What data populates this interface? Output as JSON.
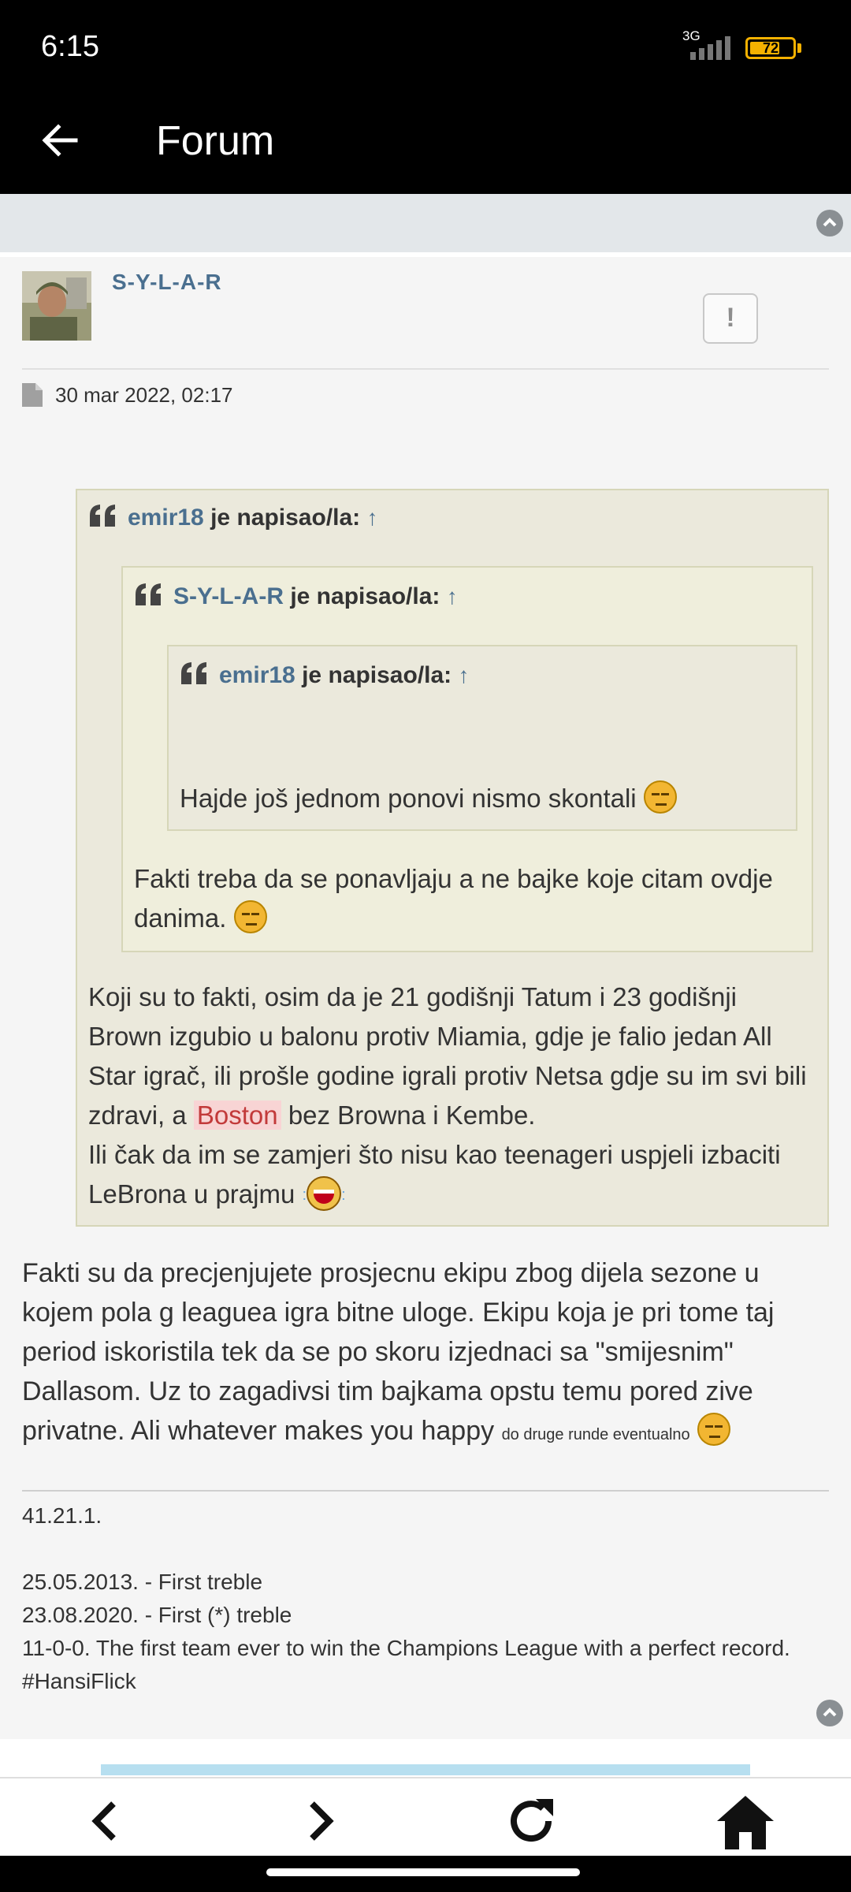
{
  "status_bar": {
    "time": "6:15",
    "network": "3G",
    "battery": "72",
    "battery_level": 0.72
  },
  "app_bar": {
    "title": "Forum"
  },
  "post": {
    "author": "S-Y-L-A-R",
    "report_label": "!",
    "date": "30 mar 2022, 02:17",
    "quote_outer": {
      "author": "emir18",
      "suffix": "je napisao/la:",
      "arrow": "↑",
      "quote_middle": {
        "author": "S-Y-L-A-R",
        "suffix": "je napisao/la:",
        "arrow": "↑",
        "quote_inner": {
          "author": "emir18",
          "suffix": "je napisao/la:",
          "arrow": "↑",
          "text": "Hajde još jednom ponovi nismo skontali"
        },
        "text": "Fakti treba da se ponavljaju a ne bajke koje citam ovdje danima."
      },
      "text_part1": "Koji su to fakti, osim da je 21 godišnji Tatum i 23 godišnji Brown izgubio u balonu protiv Miamia, gdje je falio jedan All Star igrač, ili prošle godine igrali protiv Netsa gdje su im svi bili zdravi, a",
      "highlight": "Boston",
      "text_part2": "bez Browna i Kembe.",
      "text_part3": "Ili čak da im se zamjeri što nisu kao teenageri uspjeli izbaciti LeBrona u prajmu"
    },
    "reply": "Fakti su da precjenjujete prosjecnu ekipu zbog dijela sezone u kojem pola g leaguea igra bitne uloge. Ekipu koja je pri tome taj period iskoristila tek da se po skoru izjednaci sa \"smijesnim\" Dallasom. Uz to zagadivsi tim bajkama opstu temu pored zive privatne. Ali whatever makes you happy",
    "reply_small": "do druge runde eventualno",
    "signature": [
      "41.21.1.",
      "",
      "25.05.2013. - First treble",
      "23.08.2020. - First (*) treble",
      "11-0-0. The first team ever to win the Champions League with a perfect record. #HansiFlick"
    ]
  },
  "icons": {
    "back": "arrow-left-icon",
    "scroll_top": "chevron-up-circle-icon",
    "report": "exclamation-icon",
    "date": "document-icon",
    "quote": "quote-icon",
    "nav_back": "chevron-left-icon",
    "nav_forward": "chevron-right-icon",
    "nav_reload": "reload-icon",
    "nav_home": "home-icon"
  },
  "colors": {
    "link": "#4a6f8f",
    "highlight_bg": "#f8d4d4",
    "highlight_text": "#c23a3a",
    "quote_bg": "#ebe9dc",
    "battery": "#f5b100"
  }
}
